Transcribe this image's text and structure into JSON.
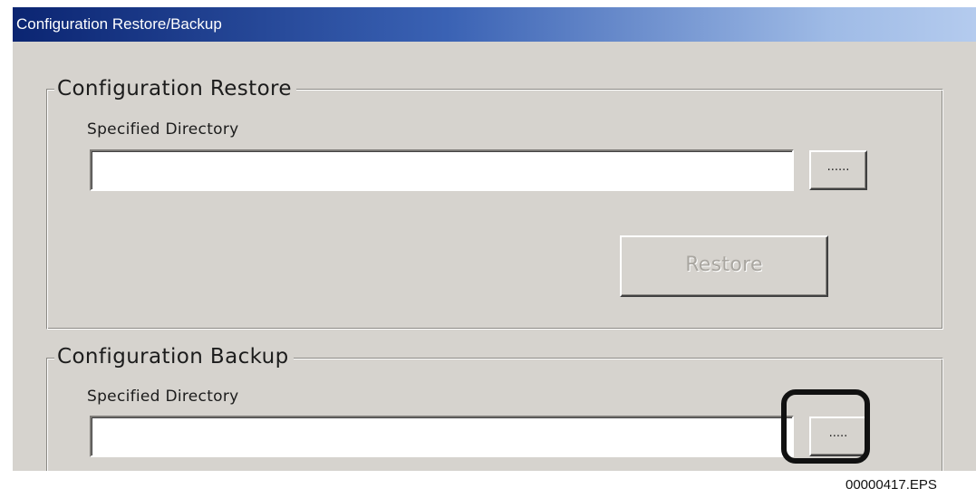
{
  "window": {
    "title": "Configuration Restore/Backup"
  },
  "restore_section": {
    "group_label": "Configuration Restore",
    "field_label": "Specified Directory",
    "directory_value": "",
    "browse_label": "......",
    "restore_button_label": "Restore",
    "restore_button_enabled": false
  },
  "backup_section": {
    "group_label": "Configuration Backup",
    "field_label": "Specified Directory",
    "directory_value": "",
    "browse_label": ".....",
    "browse_highlighted": true
  },
  "figure_id": "00000417.EPS",
  "colors": {
    "dialog_background": "#d6d3ce",
    "title_gradient_start": "#0b2572",
    "title_gradient_end": "#b4cbee",
    "disabled_text": "#a9a6a0",
    "highlight_outline": "#111111"
  }
}
